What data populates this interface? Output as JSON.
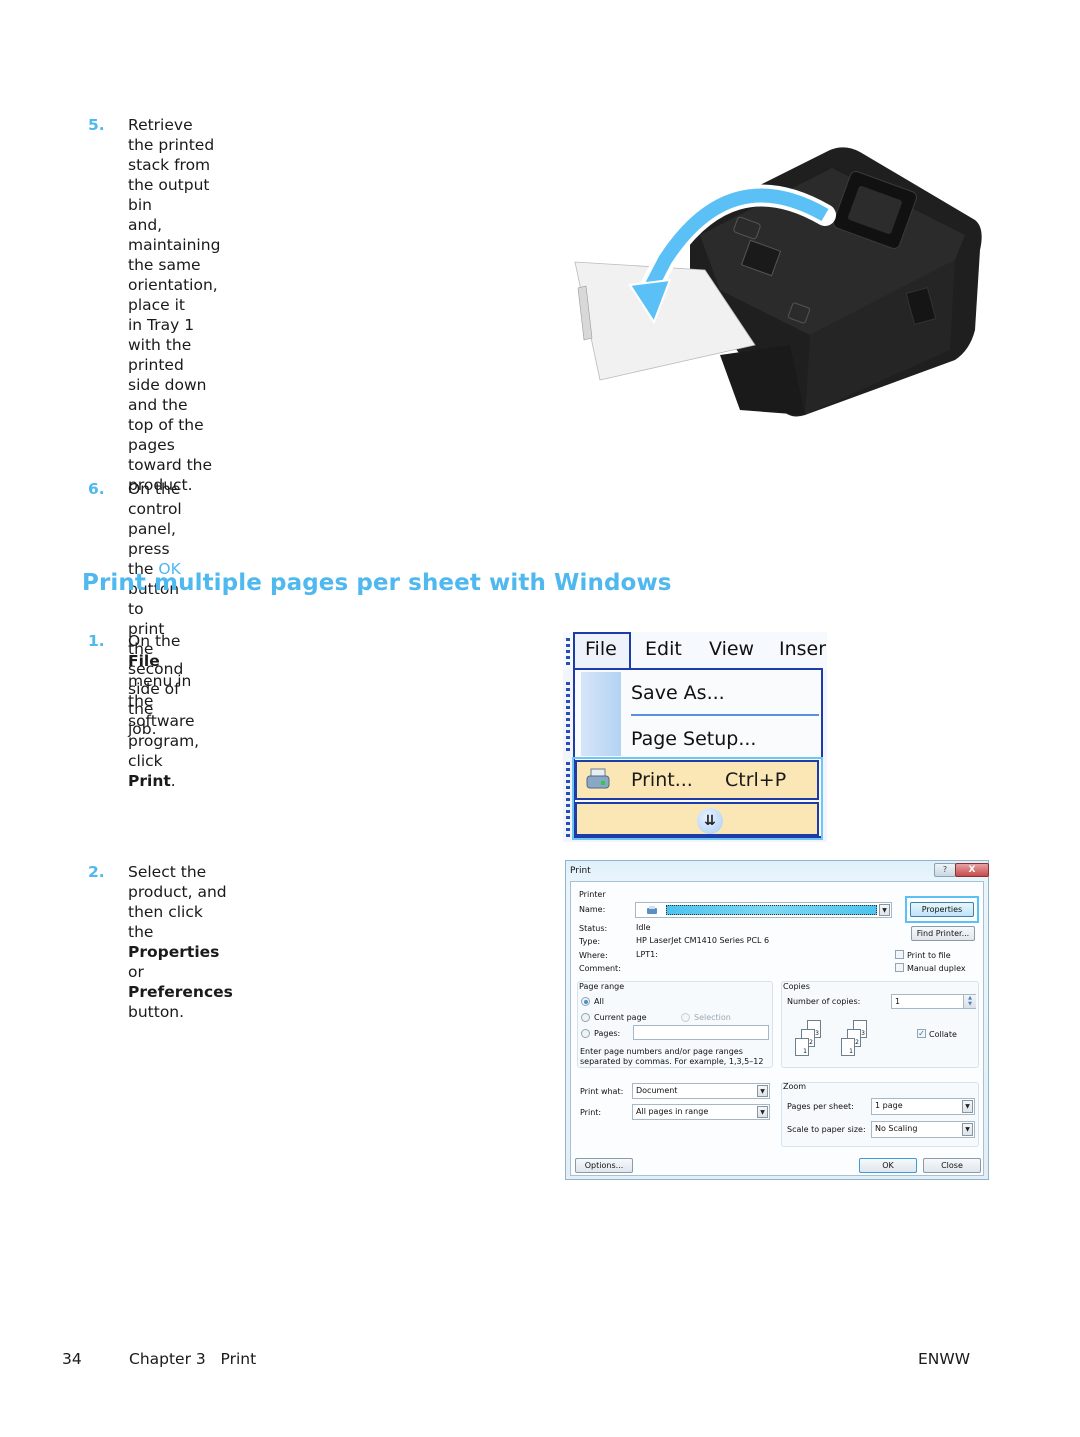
{
  "steps_top": [
    {
      "number": "5.",
      "text": "Retrieve the printed stack from the output bin\nand, maintaining the same orientation, place it\nin Tray 1 with the printed side down and the\ntop of the pages toward the product."
    },
    {
      "number": "6.",
      "text_before": "On the control panel, press the ",
      "highlight": "OK",
      "text_after": " button to\nprint the second side of the job."
    }
  ],
  "section_heading": "Print multiple pages per sheet with Windows",
  "steps_section": [
    {
      "number": "1.",
      "t1": "On the ",
      "b1": "File",
      "t2": " menu in the software program,\nclick ",
      "b2": "Print",
      "t3": "."
    },
    {
      "number": "2.",
      "t1": "Select the product, and then click the\n",
      "b1": "Properties",
      "t2": " or ",
      "b2": "Preferences",
      "t3": " button."
    }
  ],
  "illustration": {
    "name": "printer-manual-duplex-illustration",
    "arrow_color": "#5bc0f5"
  },
  "file_menu": {
    "menubar": [
      "File",
      "Edit",
      "View",
      "Inser"
    ],
    "items": [
      {
        "label": "Save As...",
        "mnemonic": "A"
      },
      {
        "label": "Page Setup...",
        "mnemonic": "u"
      },
      {
        "label": "Print...",
        "shortcut": "Ctrl+P",
        "icon": "printer-icon",
        "highlighted": true
      }
    ],
    "expand_icon": "double-chevron-down-icon"
  },
  "print_dialog": {
    "title": "Print",
    "help_label": "?",
    "close_label": "X",
    "printer_group": "Printer",
    "name_label": "Name:",
    "name_value": "",
    "status_label": "Status:",
    "status_value": "Idle",
    "type_label": "Type:",
    "type_value": "HP LaserJet CM1410 Series PCL 6",
    "where_label": "Where:",
    "where_value": "LPT1:",
    "comment_label": "Comment:",
    "comment_value": "",
    "properties_button": "Properties",
    "find_printer_button": "Find Printer...",
    "print_to_file": {
      "label": "Print to file",
      "checked": false
    },
    "manual_duplex": {
      "label": "Manual duplex",
      "checked": false
    },
    "page_range_group": "Page range",
    "range_all": {
      "label": "All",
      "selected": true
    },
    "range_current": {
      "label": "Current page",
      "selected": false
    },
    "range_selection": {
      "label": "Selection",
      "selected": false,
      "disabled": true
    },
    "range_pages": {
      "label": "Pages:",
      "selected": false,
      "value": ""
    },
    "range_hint": "Enter page numbers and/or page ranges\nseparated by commas.  For example, 1,3,5–12",
    "copies_group": "Copies",
    "copies_label": "Number of copies:",
    "copies_value": "1",
    "collate": {
      "label": "Collate",
      "checked": true
    },
    "collate_pages": [
      "3",
      "2",
      "1"
    ],
    "print_what_label": "Print what:",
    "print_what_value": "Document",
    "print_label": "Print:",
    "print_value": "All pages in range",
    "zoom_group": "Zoom",
    "pages_per_sheet_label": "Pages per sheet:",
    "pages_per_sheet_value": "1 page",
    "scale_label": "Scale to paper size:",
    "scale_value": "No Scaling",
    "options_button": "Options...",
    "ok_button": "OK",
    "close_button": "Close"
  },
  "footer": {
    "page_number": "34",
    "chapter": "Chapter 3   Print",
    "locale": "ENWW"
  }
}
